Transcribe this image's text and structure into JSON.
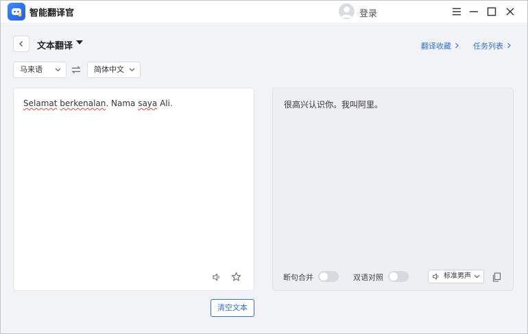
{
  "app": {
    "title": "智能翻译官",
    "login_label": "登录"
  },
  "toolbar": {
    "mode_title": "文本翻译",
    "links": {
      "favorites": "翻译收藏",
      "tasks": "任务列表"
    }
  },
  "languages": {
    "source": "马来语",
    "target": "简体中文"
  },
  "source_panel": {
    "segments": [
      {
        "text": "Selamat",
        "misspelled": true
      },
      {
        "text": " ",
        "misspelled": false
      },
      {
        "text": "berkenalan",
        "misspelled": true
      },
      {
        "text": ". Nama ",
        "misspelled": false
      },
      {
        "text": "saya",
        "misspelled": true
      },
      {
        "text": " Ali.",
        "misspelled": false
      }
    ]
  },
  "target_panel": {
    "text": "很高兴认识你。我叫阿里。",
    "options": {
      "sentence_merge": "断句合并",
      "bilingual": "双语对照"
    },
    "sentence_merge_on": false,
    "bilingual_on": false,
    "voice": "标准男声"
  },
  "actions": {
    "clear": "清空文本"
  },
  "colors": {
    "accent": "#2d6fe0",
    "misspelling": "#e34040"
  }
}
